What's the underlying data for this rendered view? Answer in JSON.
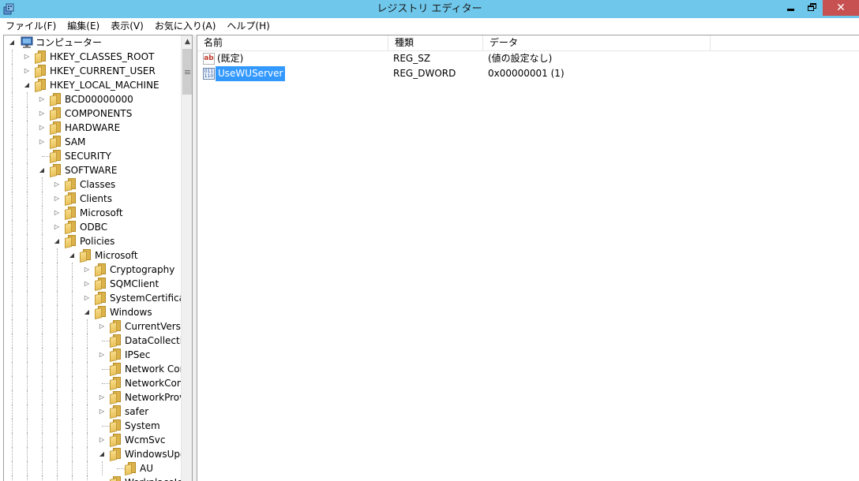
{
  "window": {
    "title": "レジストリ エディター",
    "close_glyph": "✕"
  },
  "menu": [
    {
      "label": "ファイル(F)"
    },
    {
      "label": "編集(E)"
    },
    {
      "label": "表示(V)"
    },
    {
      "label": "お気に入り(A)"
    },
    {
      "label": "ヘルプ(H)"
    }
  ],
  "tree": {
    "root": "コンピューター",
    "items": [
      {
        "label": "HKEY_CLASSES_ROOT",
        "depth": 1,
        "state": "collapsed"
      },
      {
        "label": "HKEY_CURRENT_USER",
        "depth": 1,
        "state": "collapsed"
      },
      {
        "label": "HKEY_LOCAL_MACHINE",
        "depth": 1,
        "state": "expanded"
      },
      {
        "label": "BCD00000000",
        "depth": 2,
        "state": "collapsed"
      },
      {
        "label": "COMPONENTS",
        "depth": 2,
        "state": "collapsed"
      },
      {
        "label": "HARDWARE",
        "depth": 2,
        "state": "collapsed"
      },
      {
        "label": "SAM",
        "depth": 2,
        "state": "collapsed"
      },
      {
        "label": "SECURITY",
        "depth": 2,
        "state": "leaf"
      },
      {
        "label": "SOFTWARE",
        "depth": 2,
        "state": "expanded"
      },
      {
        "label": "Classes",
        "depth": 3,
        "state": "collapsed"
      },
      {
        "label": "Clients",
        "depth": 3,
        "state": "collapsed"
      },
      {
        "label": "Microsoft",
        "depth": 3,
        "state": "collapsed"
      },
      {
        "label": "ODBC",
        "depth": 3,
        "state": "collapsed"
      },
      {
        "label": "Policies",
        "depth": 3,
        "state": "expanded"
      },
      {
        "label": "Microsoft",
        "depth": 4,
        "state": "expanded"
      },
      {
        "label": "Cryptography",
        "depth": 5,
        "state": "collapsed"
      },
      {
        "label": "SQMClient",
        "depth": 5,
        "state": "collapsed"
      },
      {
        "label": "SystemCertificates",
        "depth": 5,
        "state": "collapsed"
      },
      {
        "label": "Windows",
        "depth": 5,
        "state": "expanded"
      },
      {
        "label": "CurrentVersion",
        "depth": 6,
        "state": "collapsed"
      },
      {
        "label": "DataCollection",
        "depth": 6,
        "state": "leaf"
      },
      {
        "label": "IPSec",
        "depth": 6,
        "state": "collapsed"
      },
      {
        "label": "Network Connections",
        "depth": 6,
        "state": "leaf"
      },
      {
        "label": "NetworkConnectivityStatusIndicator",
        "depth": 6,
        "state": "leaf"
      },
      {
        "label": "NetworkProvider",
        "depth": 6,
        "state": "collapsed"
      },
      {
        "label": "safer",
        "depth": 6,
        "state": "collapsed"
      },
      {
        "label": "System",
        "depth": 6,
        "state": "leaf"
      },
      {
        "label": "WcmSvc",
        "depth": 6,
        "state": "collapsed"
      },
      {
        "label": "WindowsUpdate",
        "depth": 6,
        "state": "expanded"
      },
      {
        "label": "AU",
        "depth": 7,
        "state": "leaf"
      },
      {
        "label": "WorkplaceJoin",
        "depth": 6,
        "state": "leaf"
      }
    ]
  },
  "list": {
    "columns": [
      "名前",
      "種類",
      "データ"
    ],
    "rows": [
      {
        "name": "(既定)",
        "type": "REG_SZ",
        "data": "(値の設定なし)",
        "icon": "string-value-icon",
        "icon_text": "ab"
      },
      {
        "name": "UseWUServer",
        "type": "REG_DWORD",
        "data": "0x00000001 (1)",
        "icon": "binary-value-icon",
        "icon_text": "011 110",
        "selected": true
      }
    ]
  },
  "colors": {
    "titlebar": "#6fc8ec",
    "selection": "#3399ff",
    "folder": "#e9c25a"
  }
}
